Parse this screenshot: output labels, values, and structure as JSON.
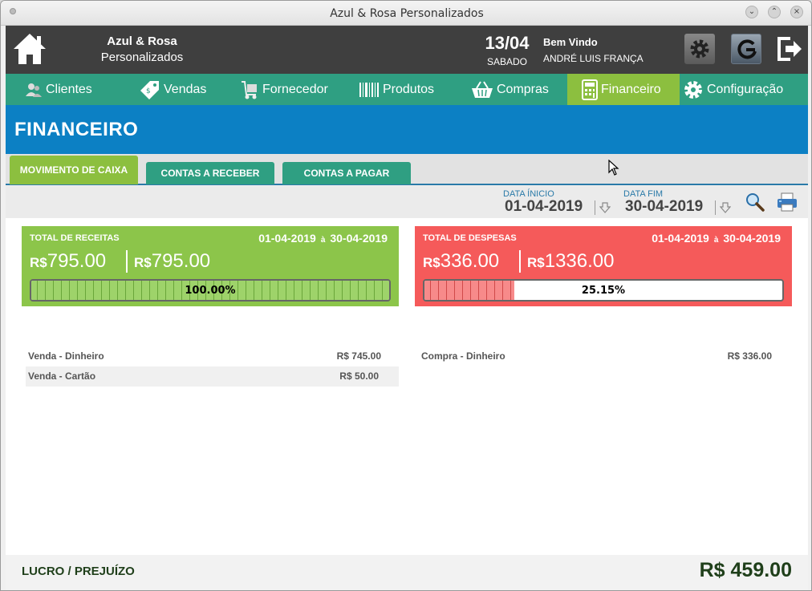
{
  "window": {
    "title": "Azul & Rosa Personalizados"
  },
  "header": {
    "brand_line1": "Azul & Rosa",
    "brand_line2": "Personalizados",
    "date": "13/04",
    "weekday": "SABADO",
    "welcome": "Bem Vindo",
    "user": "ANDRÉ LUIS FRANÇA"
  },
  "nav": {
    "items": [
      {
        "label": "Clientes",
        "icon": "users-icon"
      },
      {
        "label": "Vendas",
        "icon": "tag-icon"
      },
      {
        "label": "Fornecedor",
        "icon": "cart-supplier-icon"
      },
      {
        "label": "Produtos",
        "icon": "barcode-icon"
      },
      {
        "label": "Compras",
        "icon": "basket-icon"
      },
      {
        "label": "Financeiro",
        "icon": "calculator-icon"
      },
      {
        "label": "Configuração",
        "icon": "gear-icon"
      }
    ],
    "active": "Financeiro"
  },
  "section": {
    "title": "FINANCEIRO"
  },
  "tabs": [
    {
      "label": "MOVIMENTO DE CAIXA",
      "active": true
    },
    {
      "label": "CONTAS A RECEBER",
      "active": false
    },
    {
      "label": "CONTAS A PAGAR",
      "active": false
    }
  ],
  "filter": {
    "start_label": "DATA ÍNICIO",
    "start_value": "01-04-2019",
    "end_label": "DATA FIM",
    "end_value": "30-04-2019"
  },
  "receitas": {
    "title": "TOTAL DE RECEITAS",
    "range_start": "01-04-2019",
    "range_sep": "à",
    "range_end": "30-04-2019",
    "currency": "R$",
    "amount1": "795.00",
    "amount2": "795.00",
    "percent": 100.0,
    "percent_label": "100.00%",
    "color": "#8cc54a"
  },
  "despesas": {
    "title": "TOTAL DE DESPESAS",
    "range_start": "01-04-2019",
    "range_sep": "à",
    "range_end": "30-04-2019",
    "currency": "R$",
    "amount1": "336.00",
    "amount2": "1336.00",
    "percent": 25.15,
    "percent_label": "25.15%",
    "color": "#f55a5a"
  },
  "receitas_items": [
    {
      "label": "Venda - Dinheiro",
      "value": "R$ 745.00"
    },
    {
      "label": "Venda - Cartão",
      "value": "R$ 50.00"
    }
  ],
  "despesas_items": [
    {
      "label": "Compra - Dinheiro",
      "value": "R$ 336.00"
    }
  ],
  "footer": {
    "label": "LUCRO / PREJUÍZO",
    "value": "R$ 459.00"
  }
}
